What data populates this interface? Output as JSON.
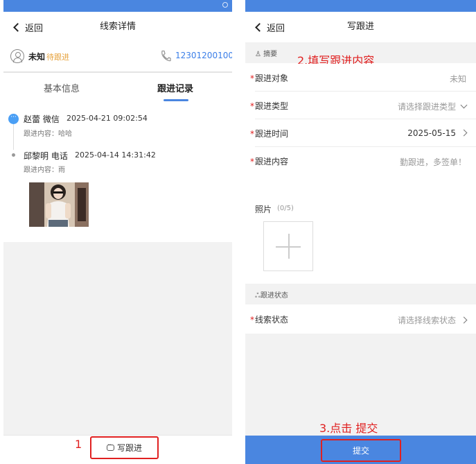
{
  "left_screen": {
    "nav": {
      "back_label": "返回",
      "title": "线索详情"
    },
    "lead": {
      "name": "未知",
      "status": "待跟进",
      "phone": "12301200100"
    },
    "tabs": {
      "basic": "基本信息",
      "records": "跟进记录"
    },
    "records": [
      {
        "person": "赵蕾",
        "type": "微信",
        "time": "2025-04-21 09:02:54",
        "content": "跟进内容：哈哈"
      },
      {
        "person": "邱黎明",
        "type": "电话",
        "time": "2025-04-14 14:31:42",
        "content": "跟进内容：雨"
      }
    ],
    "bottom": {
      "write_label": "写跟进"
    },
    "annotation": "1"
  },
  "right_screen": {
    "nav": {
      "back_label": "返回",
      "title": "写跟进"
    },
    "section_summary": "摘要",
    "annotation_fill": "2.填写跟进内容",
    "fields": {
      "target": {
        "label": "跟进对象",
        "value": "未知"
      },
      "type": {
        "label": "跟进类型",
        "placeholder": "请选择跟进类型"
      },
      "time": {
        "label": "跟进时间",
        "value": "2025-05-15"
      },
      "content": {
        "label": "跟进内容",
        "placeholder": "勤跟进，多签单！"
      }
    },
    "photos": {
      "label": "照片",
      "count": "(0/5)"
    },
    "section_status": "跟进状态",
    "lead_status": {
      "label": "线索状态",
      "placeholder": "请选择线索状态"
    },
    "annotation_submit": "3.点击 提交",
    "submit_label": "提交"
  },
  "colors": {
    "primary": "#4a86e0",
    "annotation_red": "#e02020",
    "status_orange": "#e6a23c",
    "phone_blue": "#3a7ee8"
  }
}
